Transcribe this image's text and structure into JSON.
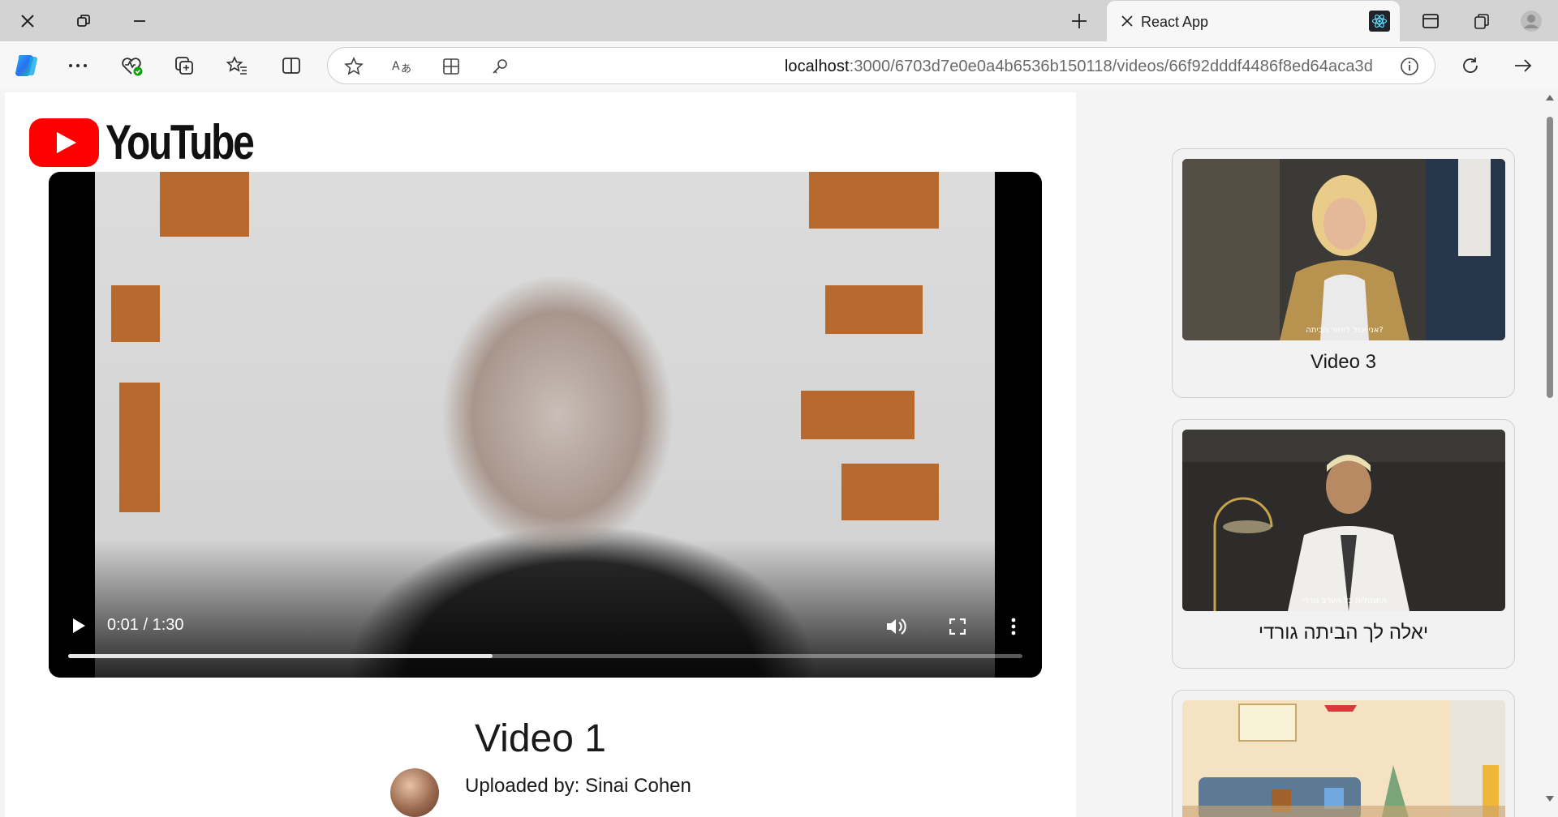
{
  "browser": {
    "tab_title": "React App",
    "url_host": "localhost",
    "url_path": ":3000/6703d7e0e0a4b6536b150118/videos/66f92dddf4486f8ed64aca3d"
  },
  "page": {
    "logo_text": "YouTube",
    "video": {
      "title": "Video 1",
      "time_display": "0:01 / 1:30",
      "progress_fraction": 0.445,
      "uploader_label": "Uploaded by: Sinai Cohen"
    },
    "related_videos": [
      {
        "title": "Video 3",
        "caption": "אני יכול לחזור הביתה?"
      },
      {
        "title": "יאלה לך הביתה גורדי",
        "caption": "התנהלות כל הערב גורדי"
      },
      {
        "title": ""
      }
    ]
  },
  "icons": {
    "close_window": "close-icon",
    "restore": "restore-icon",
    "minimize": "minimize-icon",
    "new_tab": "plus-icon",
    "copilot": "copilot-icon",
    "more": "ellipsis-icon",
    "favorites": "star-icon",
    "read_aloud": "read-aloud-icon",
    "refresh": "refresh-icon",
    "forward": "arrow-right-icon"
  },
  "colors": {
    "youtube_red": "#ff0000",
    "chrome_gray": "#d3d3d3"
  }
}
